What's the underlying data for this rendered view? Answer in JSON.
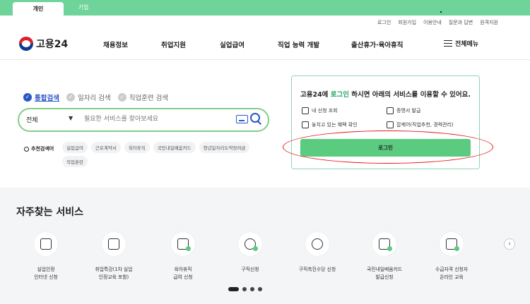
{
  "topbar": {
    "tabs": [
      {
        "label": "개인",
        "active": true
      },
      {
        "label": "기업",
        "active": false
      }
    ],
    "accent": "#6fd49a"
  },
  "utility_links": [
    "로그인",
    "회원가입",
    "이용안내",
    "질문과 답변",
    "원격지원"
  ],
  "header": {
    "logo_text": "고용24",
    "nav": [
      "채용정보",
      "취업지원",
      "실업급여",
      "직업 능력 개발",
      "출산휴가·육아휴직"
    ],
    "all_menu": "전체메뉴"
  },
  "search": {
    "tabs": [
      {
        "label": "통합검색",
        "active": true
      },
      {
        "label": "일자리 검색",
        "active": false
      },
      {
        "label": "직업훈련 검색",
        "active": false
      }
    ],
    "category": "전체",
    "placeholder": "필요한 서비스를 찾아보세요",
    "recommend_label": "추천검색어",
    "chips": [
      "실업급여",
      "근로계약서",
      "육아휴직",
      "국민내일배움카드",
      "청년일자리도약장려금",
      "직업훈련"
    ]
  },
  "login_card": {
    "title_before": "고용24에 ",
    "title_highlight": "로그인",
    "title_after": " 하시면 아래의 서비스를 이용할 수 있어요.",
    "features": [
      "내 신청 조회",
      "증명서 발급",
      "놓치고 있는 혜택 확인",
      "잡케어(직업추천, 경력관리)"
    ],
    "button": "로그인"
  },
  "frequent": {
    "title": "자주찾는 서비스",
    "items": [
      {
        "label": "실업인정\n인터넷 신청",
        "icon": "document-chat-icon"
      },
      {
        "label": "취업특강(1차 실업\n인정교육 포함)",
        "icon": "presentation-board-icon"
      },
      {
        "label": "육아휴직\n급여 신청",
        "icon": "baby-bottle-icon"
      },
      {
        "label": "구직신청",
        "icon": "person-edit-icon"
      },
      {
        "label": "구직촉진수당 신청",
        "icon": "money-bag-icon"
      },
      {
        "label": "국민내일배움카드\n발급신청",
        "icon": "card-icon"
      },
      {
        "label": "수급자격 신청자\n온라인 교육",
        "icon": "monitor-play-icon"
      }
    ],
    "next": "›"
  }
}
